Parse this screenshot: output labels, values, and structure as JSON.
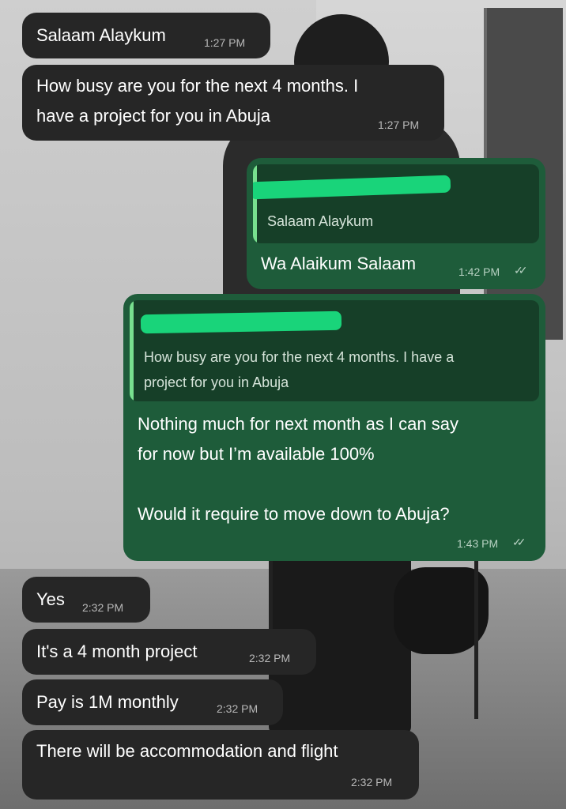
{
  "messages": [
    {
      "text": "Salaam Alaykum",
      "time": "1:27 PM"
    },
    {
      "text": "How busy are you for the next 4 months. I\nhave a project for you in Abuja",
      "time": "1:27 PM"
    },
    {
      "quote": "Salaam Alaykum",
      "text": "Wa Alaikum Salaam",
      "time": "1:42 PM",
      "status": "read"
    },
    {
      "quote": "How busy are you for the next 4 months. I have a\nproject for you in Abuja",
      "text": "Nothing much for next month as I can say\nfor now but I’m available 100%\n\nWould it require to move down to Abuja?",
      "time": "1:43 PM",
      "status": "read"
    },
    {
      "text": "Yes",
      "time": "2:32 PM"
    },
    {
      "text": "It's a 4 month project",
      "time": "2:32 PM"
    },
    {
      "text": "Pay is 1M monthly",
      "time": "2:32 PM"
    },
    {
      "text": "There will be accommodation and flight",
      "time": "2:32 PM"
    }
  ],
  "icons": {
    "read_receipt": "double-check-icon"
  },
  "colors": {
    "incoming_bubble": "#262626",
    "outgoing_bubble": "#1e5c3a",
    "quote_bar": "#78e08f",
    "redaction": "#19d47a"
  }
}
